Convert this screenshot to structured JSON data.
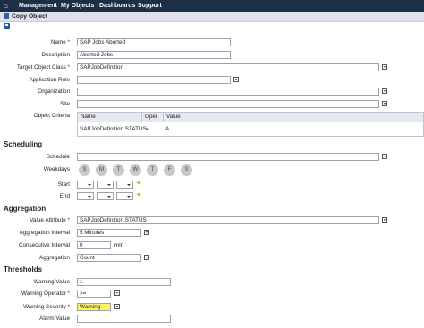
{
  "nav": {
    "items": [
      "Management",
      "My Objects",
      "Dashboards",
      "Support"
    ]
  },
  "header": {
    "title": "Copy Object"
  },
  "form": {
    "name": {
      "label": "Name",
      "required": "*",
      "value": "SAP Jobs Aborted"
    },
    "description": {
      "label": "Description",
      "value": "Aborted Jobs"
    },
    "target_class": {
      "label": "Target Object Class",
      "required": "*",
      "value": "SAPJobDefinition"
    },
    "app_role": {
      "label": "Application Role",
      "value": ""
    },
    "organization": {
      "label": "Organization",
      "value": ""
    },
    "site": {
      "label": "Site",
      "value": ""
    },
    "criteria": {
      "label": "Object Criteria",
      "columns": [
        "Name",
        "Oper",
        "Value"
      ],
      "row": [
        "SAPJobDefinition.STATUS",
        "=",
        "A"
      ]
    }
  },
  "scheduling": {
    "title": "Scheduling",
    "schedule_label": "Schedule",
    "weekdays_label": "Weekdays",
    "days": [
      "S",
      "M",
      "T",
      "W",
      "T",
      "F",
      "S"
    ],
    "start_label": "Start",
    "end_label": "End"
  },
  "aggregation": {
    "title": "Aggregation",
    "value_attr": {
      "label": "Value Attribute",
      "required": "*",
      "value": "SAPJobDefinition.STATUS"
    },
    "interval": {
      "label": "Aggregation Interval",
      "value": "5 Minutes"
    },
    "consecutive": {
      "label": "Consecutive Interval",
      "value": "0",
      "unit": "min"
    },
    "aggregation": {
      "label": "Aggregation",
      "value": "Count"
    }
  },
  "thresholds": {
    "title": "Thresholds",
    "warning_value": {
      "label": "Warning Value",
      "value": "1"
    },
    "warning_operator": {
      "label": "Warning Operator",
      "required": "*",
      "value": ">="
    },
    "warning_severity": {
      "label": "Warning Severity",
      "required": "*",
      "value": "Warning"
    },
    "alarm_value": {
      "label": "Alarm Value",
      "value": ""
    }
  }
}
